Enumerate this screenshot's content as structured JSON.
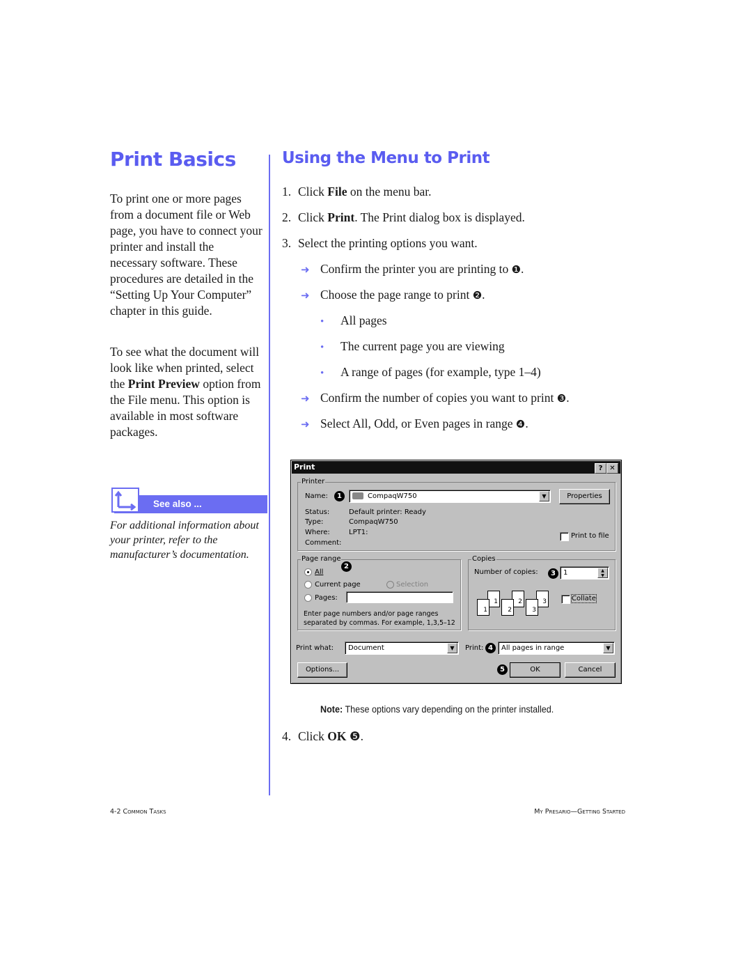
{
  "left_column": {
    "title": "Print Basics",
    "para1": "To print one or more pages from a document file or Web page, you have to connect your printer and install the necessary software. These procedures are detailed in the “Setting Up Your Computer” chapter in this guide.",
    "para2_before": "To see what the document will look like when printed, select the ",
    "para2_bold": "Print Preview",
    "para2_after": " option from the File menu. This option is available in most software packages.",
    "see_also": {
      "label": "See also ...",
      "icon": "corner-arrow-icon",
      "text": "For additional information about your printer, refer to the manufacturer’s documentation."
    }
  },
  "right_column": {
    "title": "Using the Menu to Print",
    "steps": [
      {
        "num": "1.",
        "pre": "Click ",
        "bold": "File",
        "post": " on the menu bar."
      },
      {
        "num": "2.",
        "pre": "Click ",
        "bold": "Print",
        "post": ". The Print dialog box is displayed."
      },
      {
        "num": "3.",
        "pre": "Select the printing options you want.",
        "bold": "",
        "post": ""
      },
      {
        "num": "4.",
        "pre": "Click ",
        "bold": "OK",
        "post": " ❺."
      }
    ],
    "substeps": [
      {
        "text": "Confirm the printer you are printing to ",
        "callout": "❶",
        "end": "."
      },
      {
        "text": "Choose the page range to print ",
        "callout": "❷",
        "end": "."
      },
      {
        "text": "Confirm the number of copies you want to print ",
        "callout": "❸",
        "end": "."
      },
      {
        "text": "Select All, Odd, or Even pages in range ",
        "callout": "❹",
        "end": "."
      }
    ],
    "bullets": [
      "All pages",
      "The current page you are viewing",
      "A range of pages (for example, type 1–4)"
    ],
    "arrow_glyph": "➜",
    "bullet_glyph": "•",
    "note_bold": "Note:",
    "note_text": " These options vary depending on the printer installed."
  },
  "dialog": {
    "title": "Print",
    "help_btn": "?",
    "close_btn": "✕",
    "printer_group": "Printer",
    "name_label": "Name:",
    "name_value": "CompaqW750",
    "properties_btn": "Properties",
    "status_label": "Status:",
    "status_value": "Default printer: Ready",
    "type_label": "Type:",
    "type_value": "CompaqW750",
    "where_label": "Where:",
    "where_value": "LPT1:",
    "comment_label": "Comment:",
    "print_to_file": "Print to file",
    "page_range_group": "Page range",
    "range_all": "All",
    "range_current": "Current page",
    "range_selection": "Selection",
    "range_pages": "Pages:",
    "range_hint1": "Enter page numbers and/or page ranges",
    "range_hint2": "separated by commas.  For example, 1,3,5–12",
    "copies_group": "Copies",
    "copies_label": "Number of copies:",
    "copies_value": "1",
    "collate": "Collate",
    "print_what_label": "Print what:",
    "print_what_value": "Document",
    "print_label": "Print:",
    "print_value": "All pages in range",
    "options_btn": "Options...",
    "ok_btn": "OK",
    "cancel_btn": "Cancel",
    "callouts": [
      "1",
      "2",
      "3",
      "4",
      "5"
    ],
    "collate_pages": [
      "1",
      "1",
      "2",
      "2",
      "3",
      "3"
    ]
  },
  "footer": {
    "left": "4-2  Common Tasks",
    "right": "My Presario—Getting Started"
  },
  "colors": {
    "accent": "#5a5cf0",
    "rule": "#6b6df2",
    "dialog_bg": "#c0c0c0"
  }
}
